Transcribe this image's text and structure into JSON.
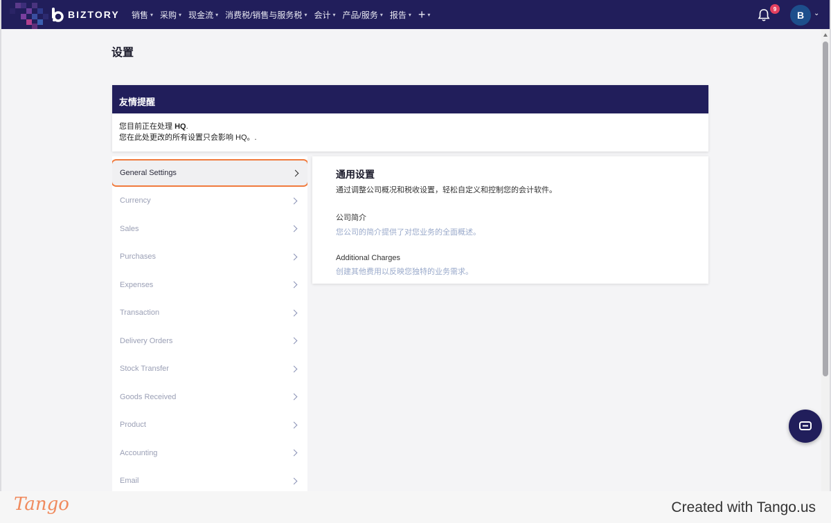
{
  "app": {
    "brand": "BIZTORY",
    "logo_icon": "biztory-logo-icon"
  },
  "nav": {
    "items": [
      {
        "label": "销售"
      },
      {
        "label": "采购"
      },
      {
        "label": "现金流"
      },
      {
        "label": "消费税/销售与服务税"
      },
      {
        "label": "会计"
      },
      {
        "label": "产品/服务"
      },
      {
        "label": "报告"
      }
    ],
    "more_label": "+",
    "notification_count": "9",
    "avatar_initial": "B"
  },
  "page": {
    "title": "设置"
  },
  "reminder": {
    "title": "友情提醒",
    "line1_prefix": "您目前正在处理 ",
    "line1_company": "HQ",
    "line1_suffix": ".",
    "line2": "您在此处更改的所有设置只会影响 HQ。."
  },
  "side_menu": {
    "items": [
      {
        "label": "General Settings"
      },
      {
        "label": "Currency"
      },
      {
        "label": "Sales"
      },
      {
        "label": "Purchases"
      },
      {
        "label": "Expenses"
      },
      {
        "label": "Transaction"
      },
      {
        "label": "Delivery Orders"
      },
      {
        "label": "Stock Transfer"
      },
      {
        "label": "Goods Received"
      },
      {
        "label": "Product"
      },
      {
        "label": "Accounting"
      },
      {
        "label": "Email"
      }
    ]
  },
  "panel": {
    "title": "通用设置",
    "description": "通过调整公司概况和税收设置，轻松自定义和控制您的会计软件。",
    "sections": [
      {
        "title": "公司简介",
        "link": "您公司的简介提供了对您业务的全面概述。"
      },
      {
        "title": "Additional Charges",
        "link": "创建其他费用以反映您独特的业务需求。"
      }
    ]
  },
  "footer": {
    "logo_text": "Tango",
    "credit": "Created with Tango.us"
  },
  "colors": {
    "topbar": "#211e5b",
    "highlight": "#f07a3c",
    "badge": "#e4405f",
    "avatar": "#1d4f8c"
  }
}
